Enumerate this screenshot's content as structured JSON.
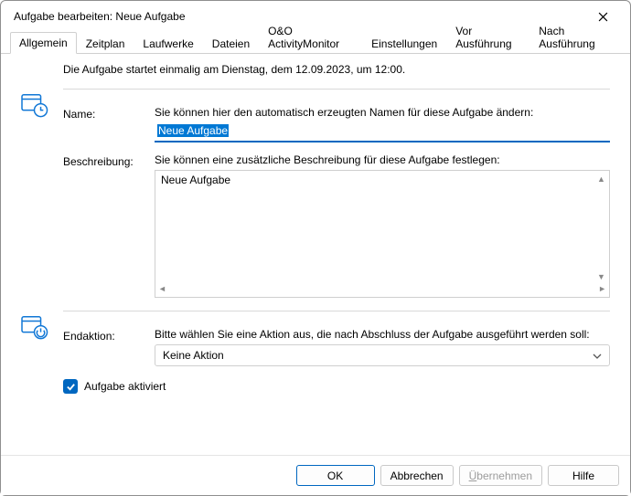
{
  "window": {
    "title": "Aufgabe bearbeiten: Neue Aufgabe"
  },
  "tabs": [
    "Allgemein",
    "Zeitplan",
    "Laufwerke",
    "Dateien",
    "O&O ActivityMonitor",
    "Einstellungen",
    "Vor Ausführung",
    "Nach Ausführung"
  ],
  "active_tab_index": 0,
  "intro_text": "Die Aufgabe startet einmalig am Dienstag, dem 12.09.2023, um 12:00.",
  "name_section": {
    "hint": "Sie können hier den automatisch erzeugten Namen für diese Aufgabe ändern:",
    "label": "Name:",
    "value": "Neue Aufgabe"
  },
  "desc_section": {
    "hint": "Sie können eine zusätzliche Beschreibung für diese Aufgabe festlegen:",
    "label": "Beschreibung:",
    "value": "Neue Aufgabe"
  },
  "end_section": {
    "hint": "Bitte wählen Sie eine Aktion aus, die nach Abschluss der Aufgabe ausgeführt werden soll:",
    "label": "Endaktion:",
    "value": "Keine Aktion"
  },
  "checkbox": {
    "label": "Aufgabe aktiviert",
    "checked": true
  },
  "buttons": {
    "ok": "OK",
    "cancel": "Abbrechen",
    "apply": "Übernehmen",
    "apply_prefix": "Ü",
    "apply_rest": "bernehmen",
    "help": "Hilfe"
  }
}
